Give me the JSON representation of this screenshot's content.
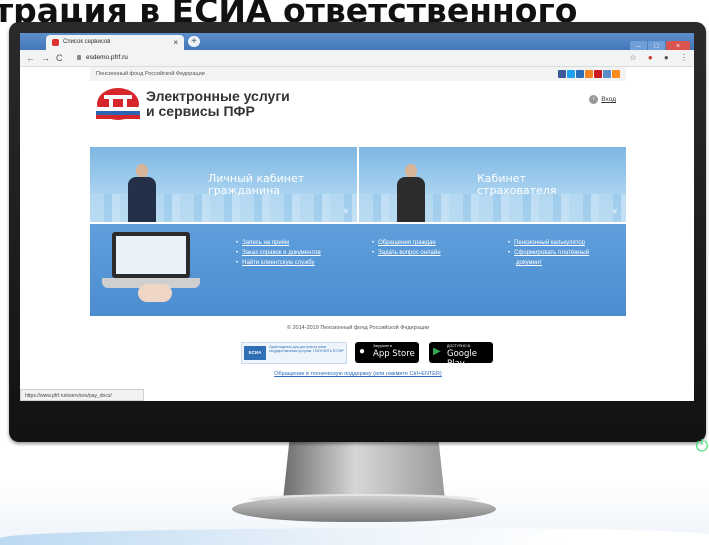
{
  "headline": "трация в ЕСИА ответственного",
  "browser": {
    "tab_title": "Список сервисов",
    "tab_close": "×",
    "new_tab": "+",
    "window_buttons": [
      "–",
      "□",
      "×"
    ],
    "nav_back": "←",
    "nav_forward": "→",
    "nav_reload": "C",
    "url": "esdemo.pfrf.ru",
    "star_icon": "☆",
    "menu_icon": "⋮",
    "account_icon": "●",
    "status_url": "https://www.pfrf.ru/eservices/pay_docs/"
  },
  "page": {
    "top_strip": "Пенсионный фонд Российской Федерации",
    "social_colors": [
      "#3b5998",
      "#1da1f2",
      "#2a6ebb",
      "#f58220",
      "#cc181e",
      "#5a8dc8",
      "#ff8c1a"
    ],
    "logo_line1": "Электронные услуги",
    "logo_line2": "и сервисы ПФР",
    "login": "Вход",
    "banner_left": {
      "line1": "Личный кабинет",
      "line2": "гражданина"
    },
    "banner_right": {
      "line1": "Кабинет",
      "line2": "страхователя"
    },
    "chevron": "»",
    "links_col1": [
      "Запись на приём",
      "Заказ справок и документов",
      "Найти клиентскую службу"
    ],
    "links_col2": [
      "Обращения граждан",
      "Задать вопрос онлайн"
    ],
    "links_col3": [
      "Пенсионный калькулятор",
      "Сформировать платёжный",
      "документ"
    ],
    "copyright": "© 2014-2019 Пенсионный фонд Российской Федерации",
    "esia_box": "ЕСИА",
    "esia_text": "Одна подпись для доступа ко всем государственным услугам. ПОЛУЧИТЬ В ПФР",
    "appstore_small": "Загрузите в",
    "appstore_big": "App Store",
    "googleplay_small": "ДОСТУПНО В",
    "googleplay_big": "Google Play",
    "support": "Обращение в техническую поддержку (или нажмите Ctrl+ENTER)"
  },
  "colors": {
    "banner_blue": "#7db7e3",
    "lower_blue": "#4b8dd0",
    "power_led": "#3fe07a"
  }
}
